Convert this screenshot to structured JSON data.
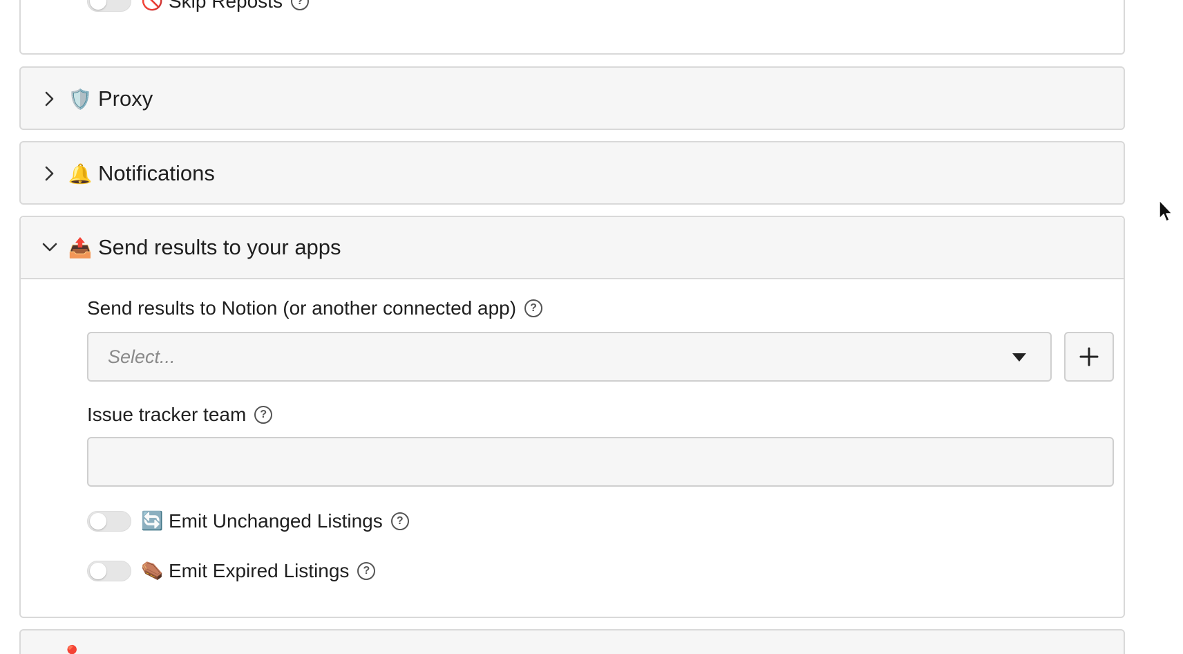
{
  "top_section": {
    "skip_reposts": {
      "emoji": "🚫",
      "label": "Skip Reposts",
      "enabled": false
    }
  },
  "sections": {
    "proxy": {
      "emoji": "🛡️",
      "title": "Proxy",
      "expanded": false
    },
    "notifications": {
      "emoji": "🔔",
      "title": "Notifications",
      "expanded": false
    },
    "send_results": {
      "emoji": "📤",
      "title": "Send results to your apps",
      "expanded": true,
      "connected_app": {
        "label": "Send results to Notion (or another connected app)",
        "placeholder": "Select..."
      },
      "issue_tracker": {
        "label": "Issue tracker team",
        "value": ""
      },
      "emit_unchanged": {
        "emoji": "🔄",
        "label": "Emit Unchanged Listings",
        "enabled": false
      },
      "emit_expired": {
        "emoji": "⚰️",
        "label": "Emit Expired Listings",
        "enabled": false
      }
    },
    "next": {
      "emoji": "📍"
    }
  },
  "icons": {
    "help": "?",
    "add": "+"
  }
}
